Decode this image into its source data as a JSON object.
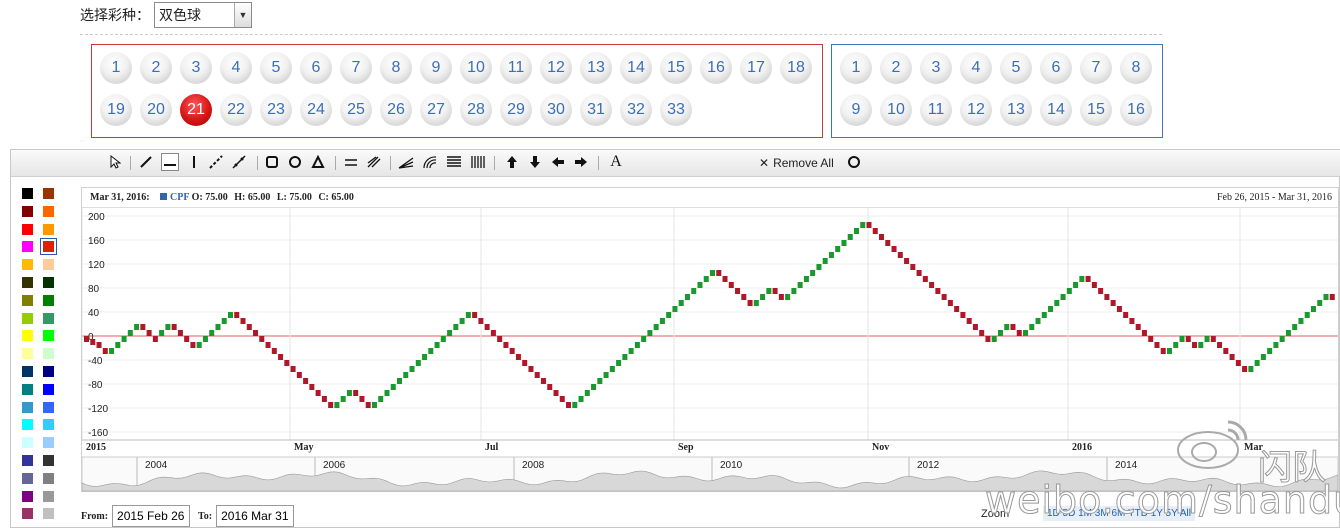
{
  "selector": {
    "label": "选择彩种：",
    "selected": "双色球"
  },
  "red_balls": [
    "1",
    "2",
    "3",
    "4",
    "5",
    "6",
    "7",
    "8",
    "9",
    "10",
    "11",
    "12",
    "13",
    "14",
    "15",
    "16",
    "17",
    "18",
    "19",
    "20",
    "21",
    "22",
    "23",
    "24",
    "25",
    "26",
    "27",
    "28",
    "29",
    "30",
    "31",
    "32",
    "33"
  ],
  "red_selected": "21",
  "blue_balls": [
    "1",
    "2",
    "3",
    "4",
    "5",
    "6",
    "7",
    "8",
    "9",
    "10",
    "11",
    "12",
    "13",
    "14",
    "15",
    "16"
  ],
  "toolbar": {
    "remove_all": "Remove All",
    "text_tool": "A"
  },
  "palette": [
    "#000000",
    "#993300",
    "#800000",
    "#ff6600",
    "#ff0000",
    "#ff9900",
    "#ff00ff",
    "#dd2200",
    "#ffbb00",
    "#ffcc99",
    "#333300",
    "#003300",
    "#808000",
    "#008000",
    "#99cc00",
    "#339966",
    "#ffff00",
    "#00ff00",
    "#ffff99",
    "#ccffcc",
    "#003366",
    "#000080",
    "#008080",
    "#0000ff",
    "#3399cc",
    "#3366ff",
    "#00ffff",
    "#33ccff",
    "#ccffff",
    "#99ccff",
    "#333399",
    "#333333",
    "#666699",
    "#808080",
    "#800080",
    "#999999",
    "#993366",
    "#c0c0c0"
  ],
  "info": {
    "date": "Mar 31, 2016:",
    "symbol": "CPF",
    "o": "O: 75.00",
    "h": "H: 65.00",
    "l": "L: 75.00",
    "c": "C: 65.00",
    "range": "Feb 26, 2015 - Mar 31, 2016"
  },
  "chart_data": {
    "type": "line",
    "subtype": "renko",
    "y_ticks": [
      "200",
      "160",
      "120",
      "80",
      "40",
      "0",
      "-40",
      "-80",
      "-120",
      "-160"
    ],
    "ylim": [
      -170,
      215
    ],
    "x_ticks": [
      "2015",
      "May",
      "Jul",
      "Sep",
      "Nov",
      "2016",
      "Mar"
    ],
    "brick_size": 10,
    "up_color": "#1a9a2e",
    "down_color": "#b0182a",
    "zero_line_color": "#e06060",
    "grid": true,
    "bricks": [
      -5,
      -10,
      -20,
      -30,
      -20,
      -10,
      0,
      10,
      20,
      10,
      0,
      -10,
      10,
      20,
      10,
      0,
      -10,
      -20,
      -10,
      0,
      10,
      20,
      30,
      40,
      30,
      20,
      10,
      0,
      -10,
      -20,
      -30,
      -40,
      -50,
      -60,
      -70,
      -80,
      -90,
      -100,
      -110,
      -120,
      -110,
      -100,
      -90,
      -100,
      -110,
      -120,
      -110,
      -100,
      -90,
      -80,
      -70,
      -60,
      -50,
      -40,
      -30,
      -20,
      -10,
      0,
      10,
      20,
      30,
      40,
      30,
      20,
      10,
      0,
      -10,
      -20,
      -30,
      -40,
      -50,
      -60,
      -70,
      -80,
      -90,
      -100,
      -110,
      -120,
      -110,
      -100,
      -90,
      -80,
      -70,
      -60,
      -50,
      -40,
      -30,
      -20,
      -10,
      0,
      10,
      20,
      30,
      40,
      50,
      60,
      70,
      80,
      90,
      100,
      110,
      100,
      90,
      80,
      70,
      60,
      50,
      60,
      70,
      80,
      70,
      60,
      70,
      80,
      90,
      100,
      110,
      120,
      130,
      140,
      150,
      160,
      170,
      180,
      190,
      180,
      170,
      160,
      150,
      140,
      130,
      120,
      110,
      100,
      90,
      80,
      70,
      60,
      50,
      40,
      30,
      20,
      10,
      0,
      -10,
      0,
      10,
      20,
      10,
      0,
      10,
      20,
      30,
      40,
      50,
      60,
      70,
      80,
      90,
      100,
      90,
      80,
      70,
      60,
      50,
      40,
      30,
      20,
      10,
      0,
      -10,
      -20,
      -30,
      -20,
      -10,
      0,
      -10,
      -20,
      -10,
      0,
      -10,
      -20,
      -30,
      -40,
      -50,
      -60,
      -50,
      -40,
      -30,
      -20,
      -10,
      0,
      10,
      20,
      30,
      40,
      50,
      60,
      70,
      60
    ]
  },
  "navigator": {
    "years": [
      "2004",
      "2006",
      "2008",
      "2010",
      "2012",
      "2014"
    ]
  },
  "from_to": {
    "from_label": "From:",
    "from_value": "2015 Feb 26",
    "to_label": "To:",
    "to_value": "2016 Mar 31"
  },
  "zoom": {
    "label": "Zoom",
    "links": "1D 5D 1M 3M 6M YTD 1Y 5Y All"
  },
  "watermark": {
    "site": "weibo.com/shandui",
    "name": "闪队"
  }
}
